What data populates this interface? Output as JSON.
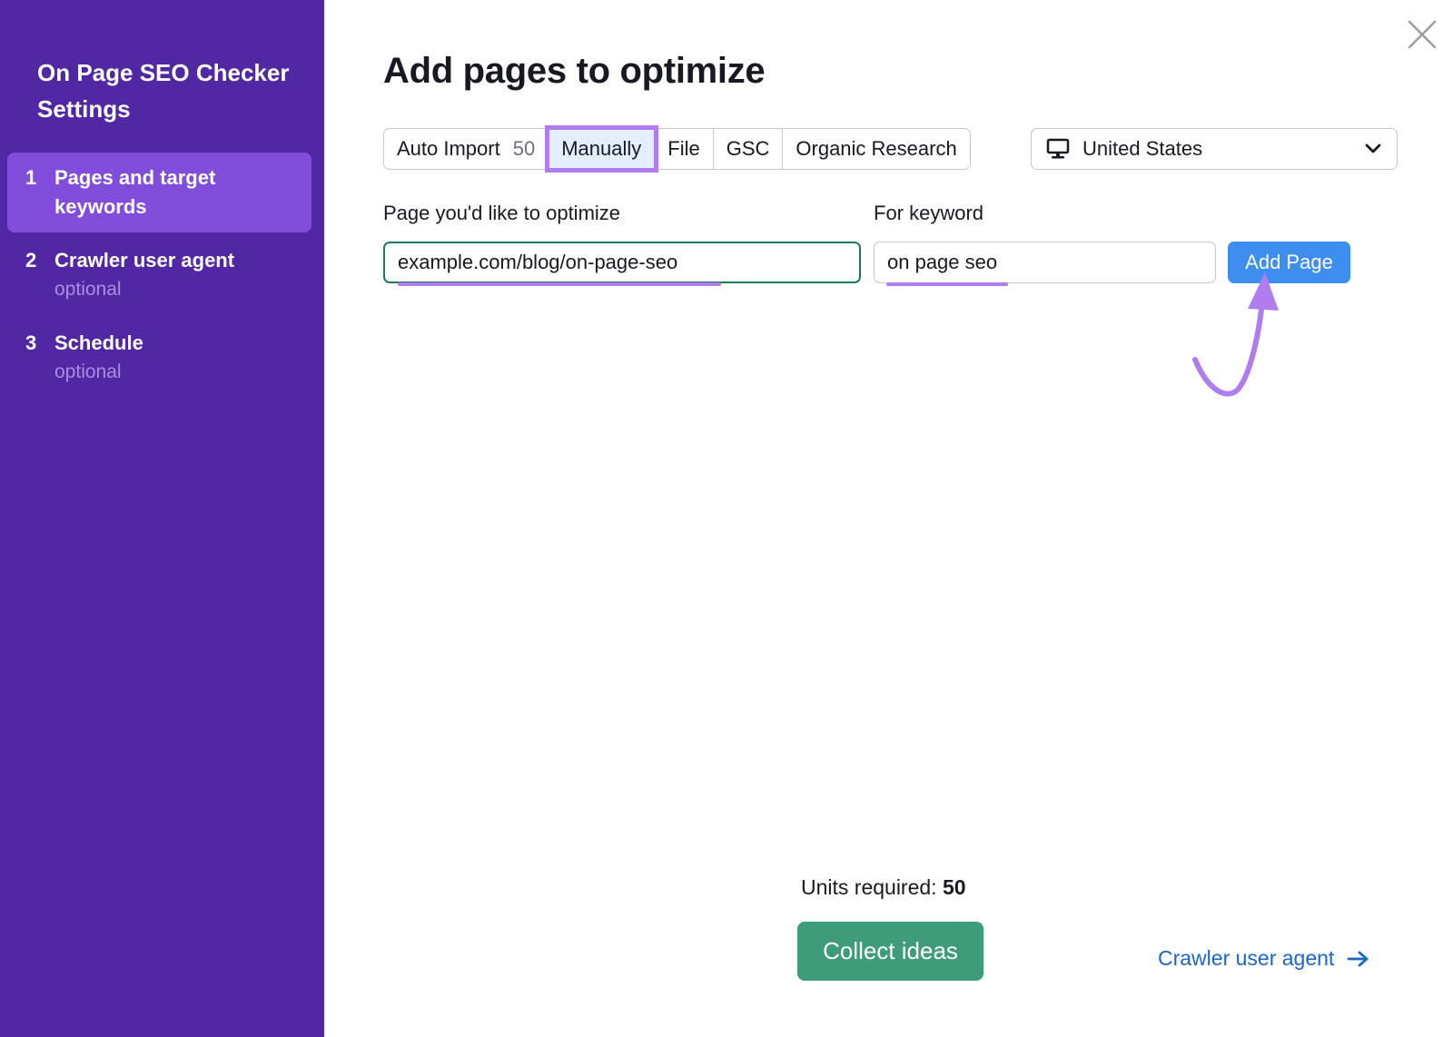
{
  "sidebar": {
    "title": "On Page SEO Checker Settings",
    "steps": [
      {
        "num": "1",
        "label": "Pages and target keywords",
        "sub": ""
      },
      {
        "num": "2",
        "label": "Crawler user agent",
        "sub": "optional"
      },
      {
        "num": "3",
        "label": "Schedule",
        "sub": "optional"
      }
    ]
  },
  "main": {
    "title": "Add pages to optimize",
    "tabs": [
      {
        "label": "Auto Import",
        "count": "50"
      },
      {
        "label": "Manually"
      },
      {
        "label": "File"
      },
      {
        "label": "GSC"
      },
      {
        "label": "Organic Research"
      }
    ],
    "location": {
      "value": "United States",
      "icon": "monitor-icon"
    },
    "page_field": {
      "label": "Page you'd like to optimize",
      "value": "example.com/blog/on-page-seo"
    },
    "keyword_field": {
      "label": "For keyword",
      "value": "on page seo"
    },
    "add_page_label": "Add Page",
    "units_label": "Units required:",
    "units_value": "50",
    "collect_label": "Collect ideas",
    "next_link_label": "Crawler user agent"
  },
  "colors": {
    "sidebar_bg": "#5127a4",
    "sidebar_active": "#814ddb",
    "highlight": "#b07df0",
    "primary_blue": "#3e8ef0",
    "primary_green": "#3f9c7a",
    "link": "#1a65c9"
  }
}
